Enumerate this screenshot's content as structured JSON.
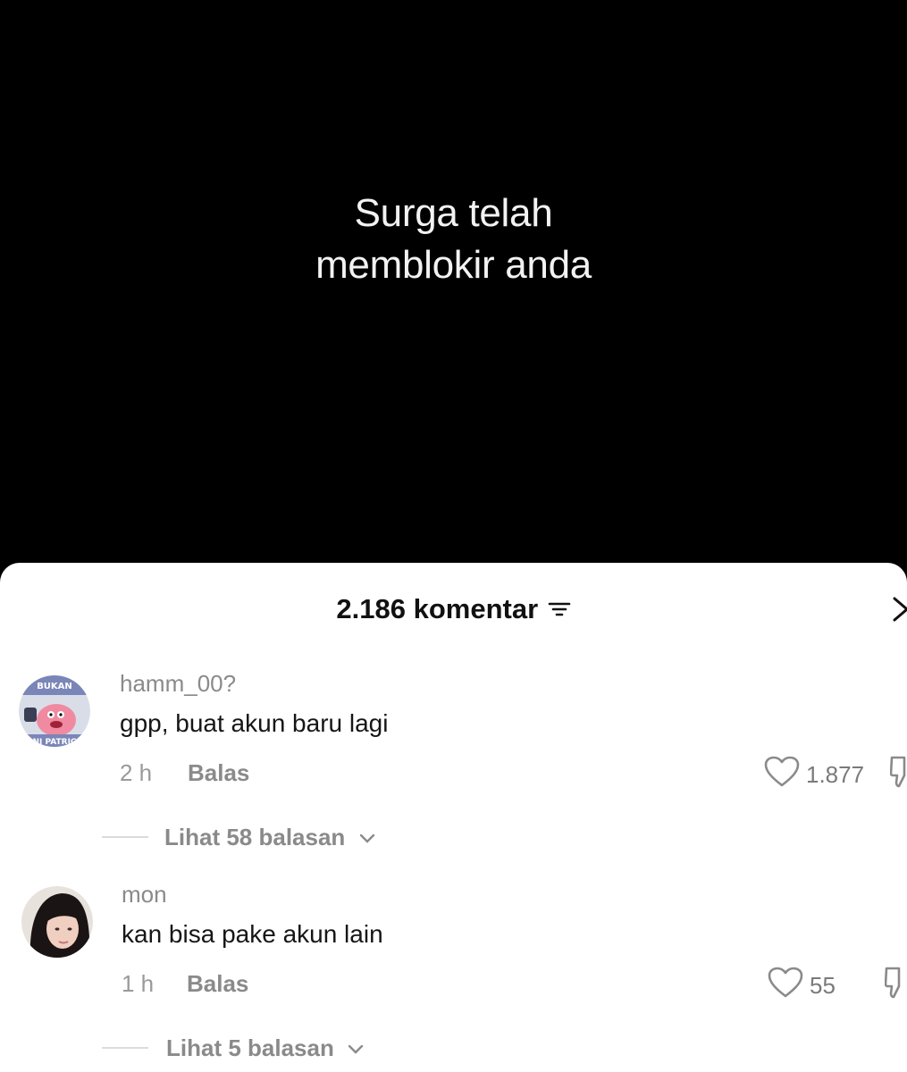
{
  "video": {
    "caption": "Surga telah\nmemblokir anda"
  },
  "comments_panel": {
    "title": "2.186 komentar",
    "icons": {
      "filter": "filter-lines-icon",
      "close": "close-x-icon"
    }
  },
  "comments": [
    {
      "username": "hamm_00?",
      "text": "gpp, buat akun baru lagi",
      "time": "2 h",
      "reply_label": "Balas",
      "likes": "1.877",
      "view_replies": "Lihat 58 balasan",
      "avatar_text_top": "BUKAN",
      "avatar_text_bottom": "NI PATRIC"
    },
    {
      "username": "mon",
      "text": "kan bisa pake akun lain",
      "time": "1 h",
      "reply_label": "Balas",
      "likes": "55",
      "view_replies": "Lihat 5 balasan"
    }
  ],
  "colors": {
    "background": "#000000",
    "sheet": "#ffffff",
    "muted_text": "#8a8a8a",
    "primary_text": "#161616"
  }
}
